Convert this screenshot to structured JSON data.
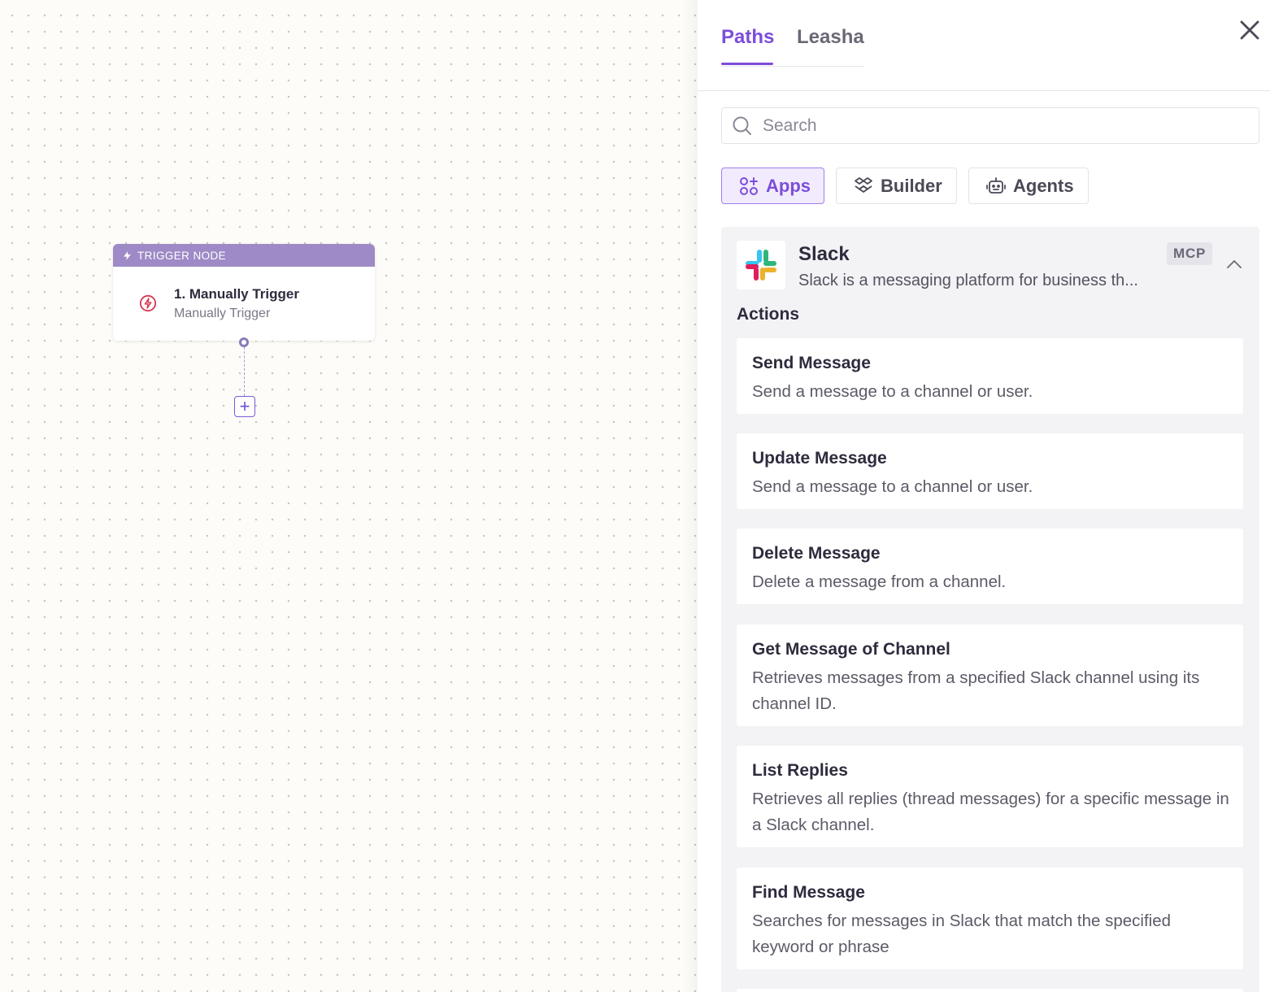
{
  "canvas": {
    "trigger_node": {
      "header_label": "TRIGGER NODE",
      "title": "1. Manually Trigger",
      "subtitle": "Manually Trigger",
      "header_color": "#9d8ac6"
    },
    "add_button_label": "+"
  },
  "panel": {
    "tabs": [
      {
        "label": "Paths",
        "active": true
      },
      {
        "label": "Leasha",
        "active": false
      }
    ],
    "search": {
      "placeholder": "Search",
      "value": ""
    },
    "filters": [
      {
        "label": "Apps",
        "icon": "apps-icon",
        "active": true
      },
      {
        "label": "Builder",
        "icon": "builder-icon",
        "active": false
      },
      {
        "label": "Agents",
        "icon": "robot-icon",
        "active": false
      }
    ],
    "app": {
      "name": "Slack",
      "description": "Slack is a messaging platform for business th...",
      "badge": "MCP",
      "actions_heading": "Actions",
      "actions": [
        {
          "title": "Send Message",
          "description": "Send a message to a channel or user."
        },
        {
          "title": "Update Message",
          "description": "Send a message to a channel or user."
        },
        {
          "title": "Delete Message",
          "description": "Delete a message from a channel."
        },
        {
          "title": "Get Message of Channel",
          "description": "Retrieves messages from a specified Slack channel using its channel ID."
        },
        {
          "title": "List Replies",
          "description": "Retrieves all replies (thread messages) for a specific message in a Slack channel."
        },
        {
          "title": "Find Message",
          "description": "Searches for messages in Slack that match the specified keyword or phrase"
        }
      ]
    },
    "accent_color": "#7c4ddb"
  }
}
